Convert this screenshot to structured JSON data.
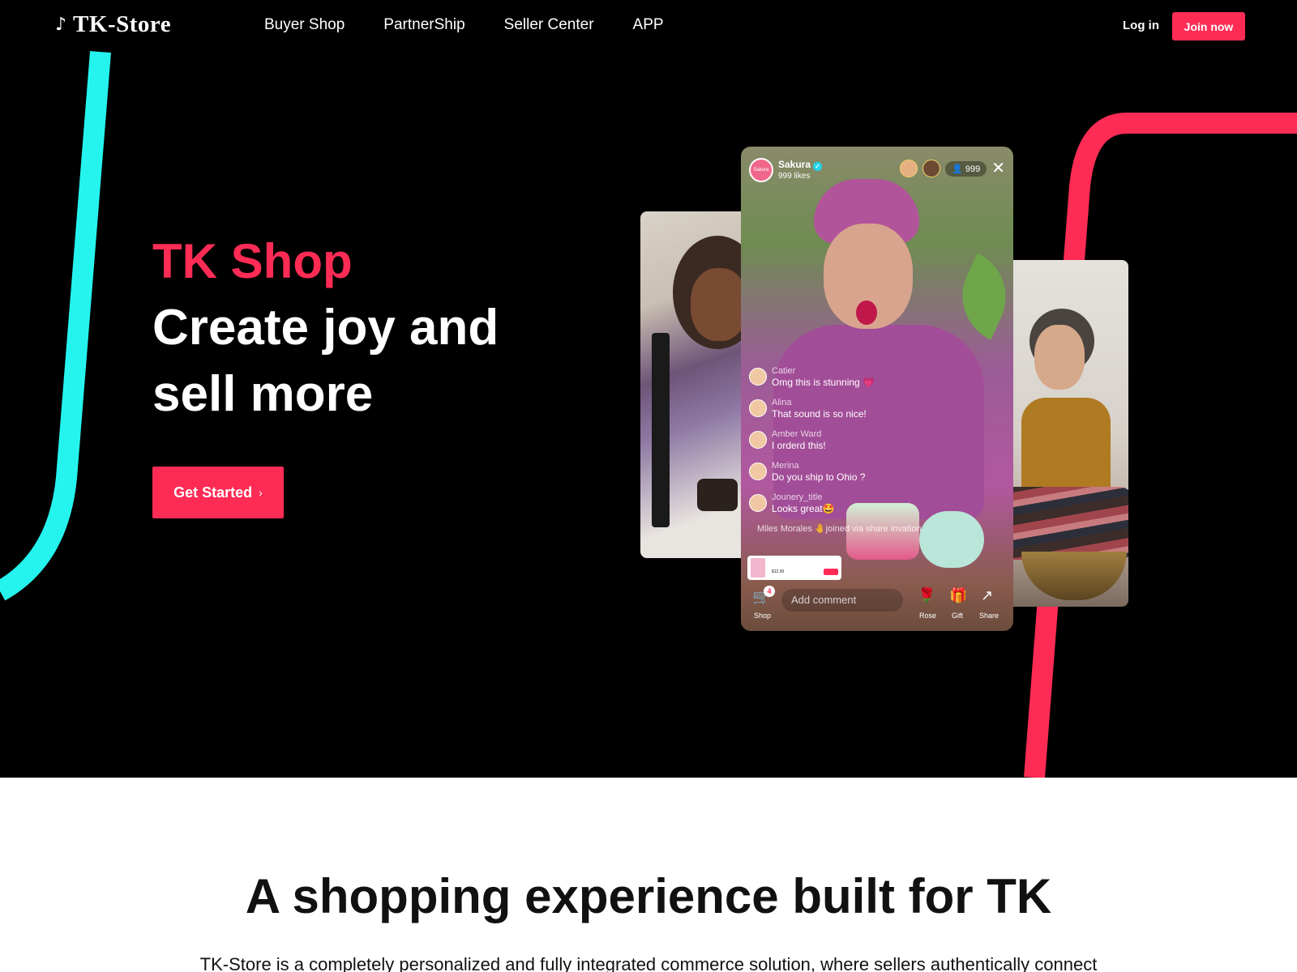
{
  "header": {
    "brand": "TK-Store",
    "nav": [
      "Buyer Shop",
      "PartnerShip",
      "Seller Center",
      "APP"
    ],
    "login_label": "Log in",
    "join_label": "Join now"
  },
  "hero": {
    "kicker": "TK Shop",
    "title": "Create joy and sell more",
    "cta_label": "Get Started"
  },
  "live": {
    "host_badge": "Sakura",
    "host_name": "Sakura",
    "likes": "999 likes",
    "viewer_count": "999",
    "comments": [
      {
        "user": "Catier",
        "text": "Omg this is stunning 💗"
      },
      {
        "user": "Alina",
        "text": "That sound is so nice!"
      },
      {
        "user": "Amber Ward",
        "text": "I orderd this!"
      },
      {
        "user": "Merina",
        "text": "Do you ship to Ohio ?"
      },
      {
        "user": "Jounery_title",
        "text": "Looks great🤩"
      }
    ],
    "joined": "Miles Morales 🤚joined via share invation",
    "product_price": "$12.00",
    "cart_count": "4",
    "shop_label": "Shop",
    "comment_placeholder": "Add comment",
    "rose_label": "Rose",
    "gift_label": "Gift",
    "share_label": "Share"
  },
  "section2": {
    "title": "A shopping experience built for TK",
    "text": "TK-Store is a completely personalized and fully integrated commerce solution, where sellers authentically connect"
  },
  "colors": {
    "accent_red": "#fe2c55",
    "accent_cyan": "#25f4ee",
    "background": "#000000"
  }
}
